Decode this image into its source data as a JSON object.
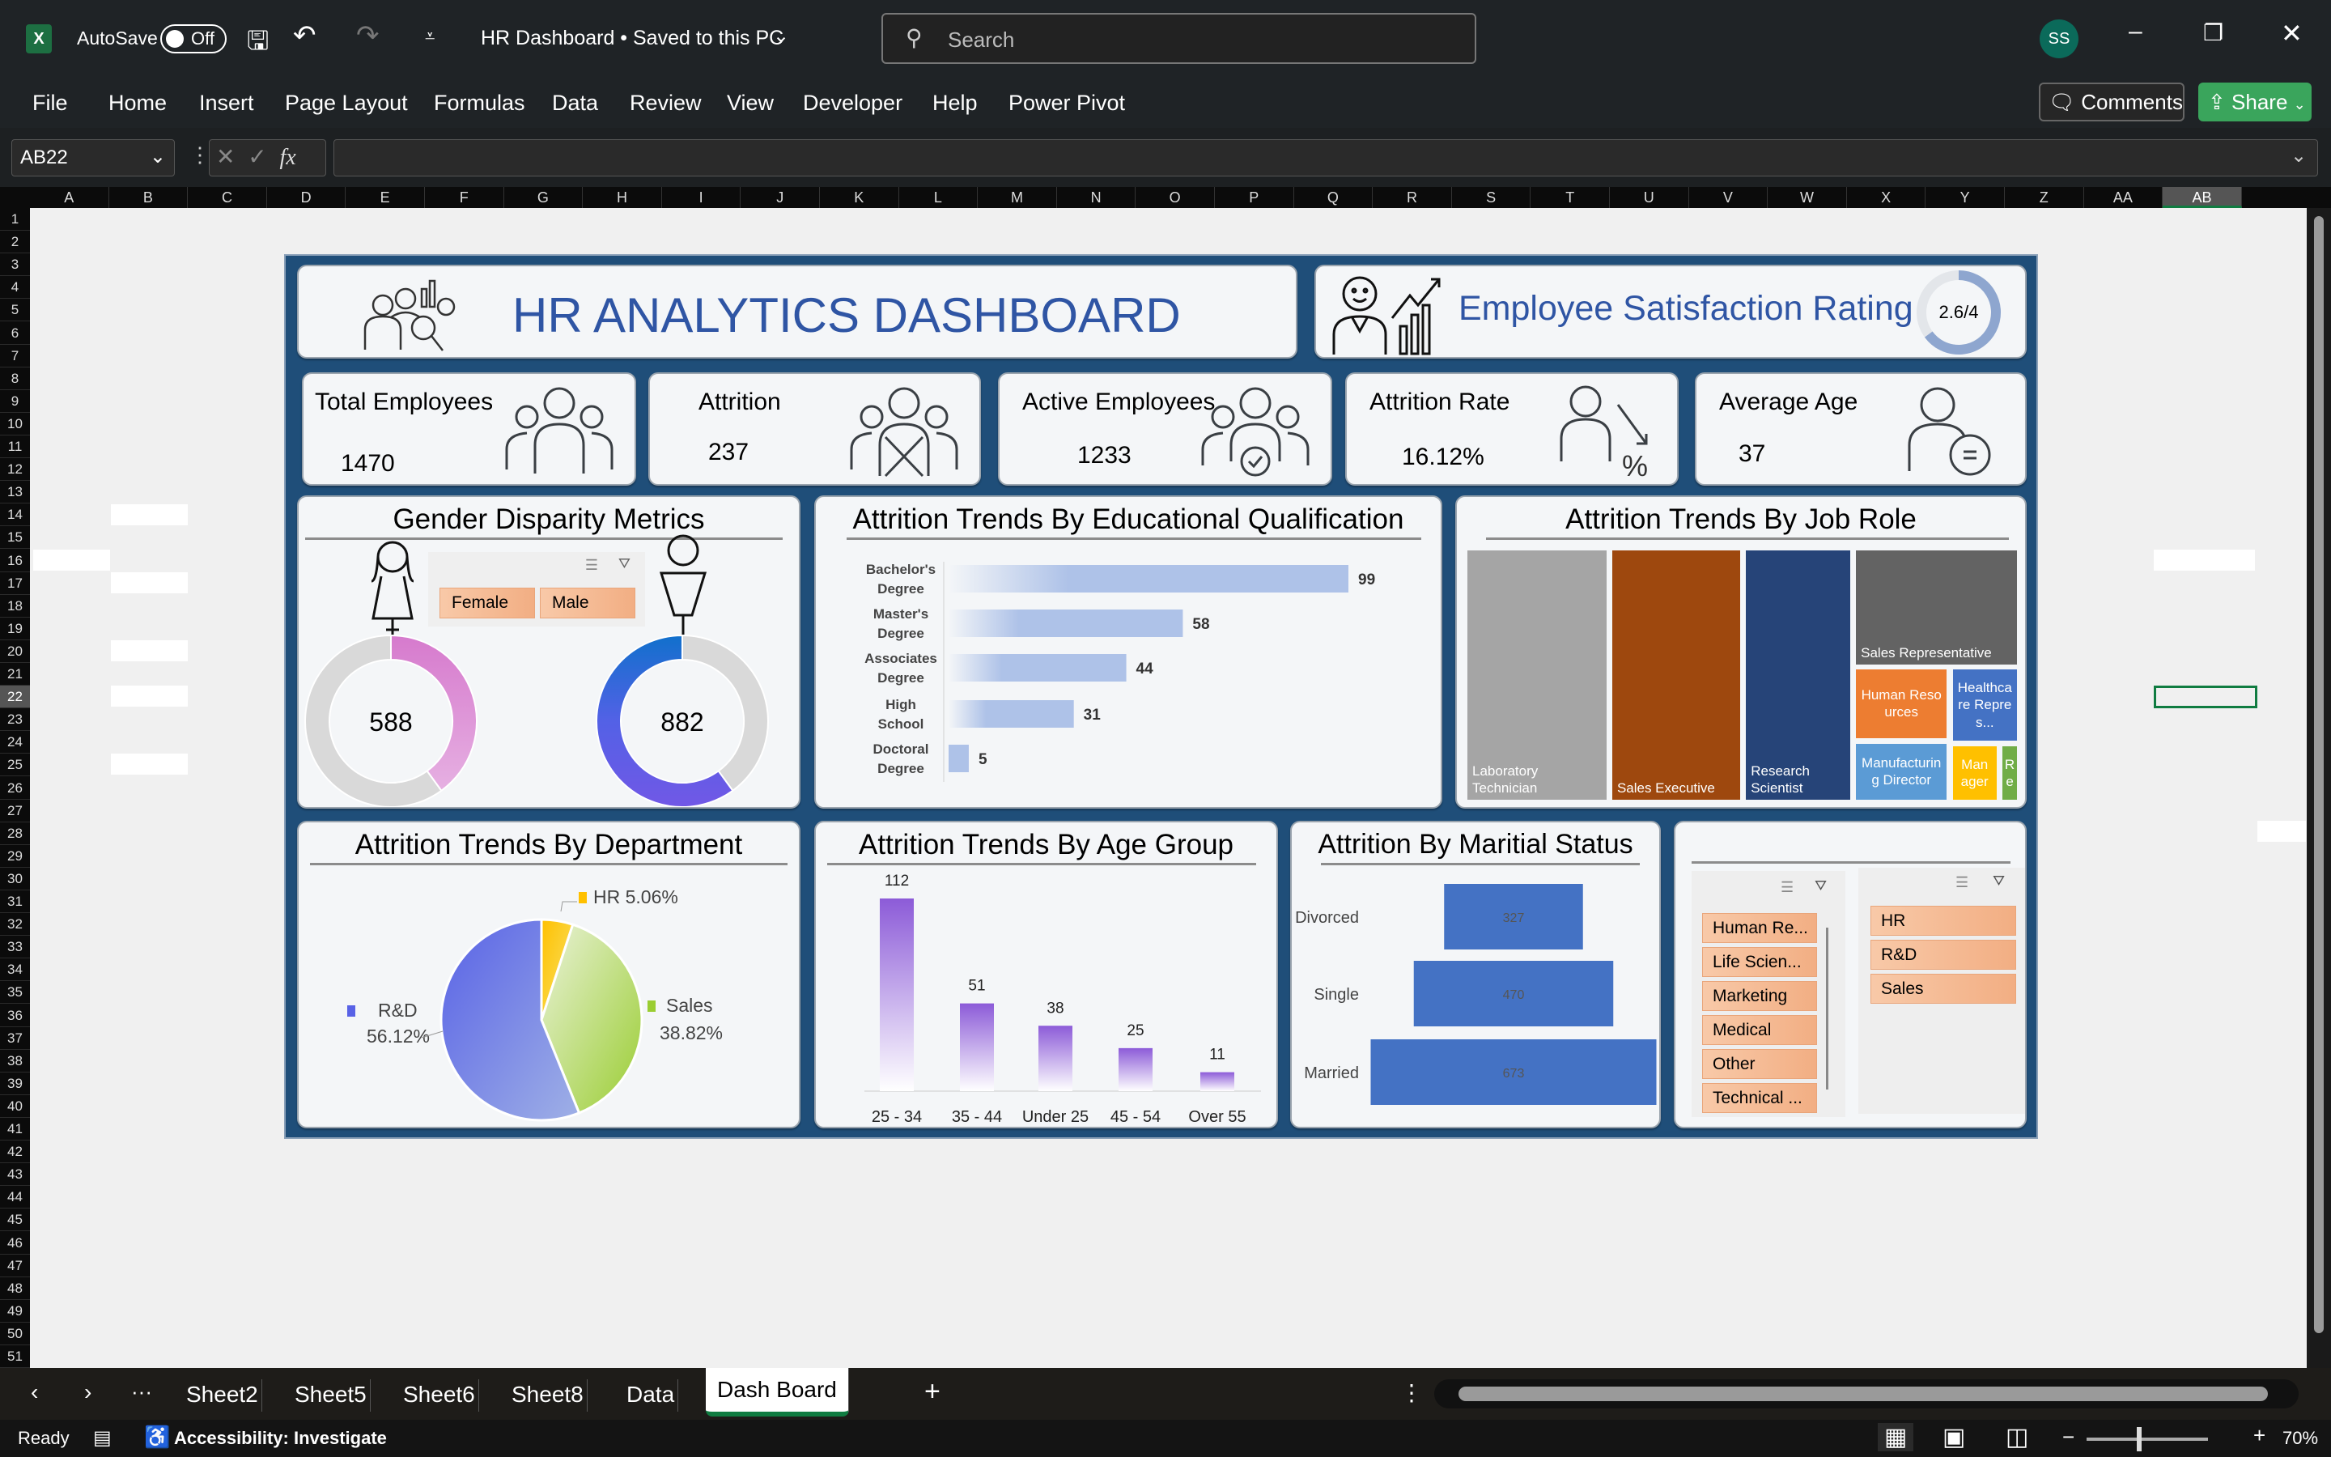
{
  "titlebar": {
    "autosave_label": "AutoSave",
    "autosave_state": "Off",
    "doc_title": "HR Dashboard • Saved to this PC",
    "search_placeholder": "Search",
    "avatar_initials": "SS"
  },
  "menu": {
    "tabs": [
      "File",
      "Home",
      "Insert",
      "Page Layout",
      "Formulas",
      "Data",
      "Review",
      "View",
      "Developer",
      "Help",
      "Power Pivot"
    ],
    "comments_label": "Comments",
    "share_label": "Share"
  },
  "formula_bar": {
    "name_box": "AB22",
    "fx_label": "fx",
    "formula": ""
  },
  "grid": {
    "columns": [
      "A",
      "B",
      "C",
      "D",
      "E",
      "F",
      "G",
      "H",
      "I",
      "J",
      "K",
      "L",
      "M",
      "N",
      "O",
      "P",
      "Q",
      "R",
      "S",
      "T",
      "U",
      "V",
      "W",
      "X",
      "Y",
      "Z",
      "AA",
      "AB"
    ],
    "row_count": 51,
    "selected_cell": "AB22"
  },
  "sheets": {
    "tabs": [
      "Sheet2",
      "Sheet5",
      "Sheet6",
      "Sheet8",
      "Data",
      "Dash Board"
    ],
    "active": "Dash Board"
  },
  "status": {
    "ready": "Ready",
    "accessibility": "Accessibility: Investigate",
    "zoom": "70%"
  },
  "dashboard": {
    "title": "HR ANALYTICS DASHBOARD",
    "satisfaction": {
      "label": "Employee Satisfaction Rating",
      "value_text": "2.6/4",
      "value": 2.6,
      "max": 4
    },
    "kpis": [
      {
        "label": "Total Employees",
        "value": "1470"
      },
      {
        "label": "Attrition",
        "value": "237"
      },
      {
        "label": "Active Employees",
        "value": "1233"
      },
      {
        "label": "Attrition Rate",
        "value": "16.12%"
      },
      {
        "label": "Average Age",
        "value": "37"
      }
    ],
    "gender": {
      "title": "Gender Disparity Metrics",
      "slicer": [
        "Female",
        "Male"
      ],
      "female": 588,
      "male": 882,
      "total": 1470,
      "female_color": "#d87fd0",
      "male_color": "#5a5de6"
    },
    "slicers": {
      "education_field": [
        "Human Re...",
        "Life Scien...",
        "Marketing",
        "Medical",
        "Other",
        "Technical ..."
      ],
      "department": [
        "HR",
        "R&D",
        "Sales"
      ]
    },
    "treemap": {
      "title": "Attrition Trends By Job Role",
      "tiles": [
        {
          "label": "Laboratory Technician",
          "color": "#a5a5a5"
        },
        {
          "label": "Sales Executive",
          "color": "#9e480e"
        },
        {
          "label": "Research Scientist",
          "color": "#264478"
        },
        {
          "label": "Sales Representative",
          "color": "#636363"
        },
        {
          "label": "Human Resources",
          "color": "#ed7d31"
        },
        {
          "label": "Healthcare Repres...",
          "color": "#4472c4"
        },
        {
          "label": "Manufacturing Director",
          "color": "#5b9bd5"
        },
        {
          "label": "Manager",
          "color": "#ffc000"
        },
        {
          "label": "Re",
          "color": "#70ad47"
        }
      ]
    }
  },
  "chart_data": [
    {
      "type": "bar",
      "orientation": "horizontal",
      "title": "Attrition Trends By Educational Qualification",
      "categories": [
        "Bachelor's Degree",
        "Master's Degree",
        "Associates Degree",
        "High School",
        "Doctoral Degree"
      ],
      "values": [
        99,
        58,
        44,
        31,
        5
      ],
      "color": "#aec2e8"
    },
    {
      "type": "pie",
      "title": "Attrition Trends By Department",
      "categories": [
        "HR",
        "Sales",
        "R&D"
      ],
      "values": [
        5.06,
        38.82,
        56.12
      ],
      "labels": [
        "HR 5.06%",
        "Sales",
        "R&D"
      ],
      "pct_labels": [
        "",
        "38.82%",
        "56.12%"
      ],
      "colors": [
        "#ffc000",
        "#9acd32",
        "#5862e6"
      ]
    },
    {
      "type": "bar",
      "title": "Attrition Trends By Age Group",
      "categories": [
        "25 - 34",
        "35 - 44",
        "Under 25",
        "45 - 54",
        "Over 55"
      ],
      "values": [
        112,
        51,
        38,
        25,
        11
      ],
      "color": "#8c5bd8"
    },
    {
      "type": "bar",
      "orientation": "horizontal",
      "title": "Attrition By Maritial Status",
      "categories": [
        "Divorced",
        "Single",
        "Married"
      ],
      "values": [
        327,
        470,
        673
      ],
      "color": "#4472c4"
    }
  ]
}
